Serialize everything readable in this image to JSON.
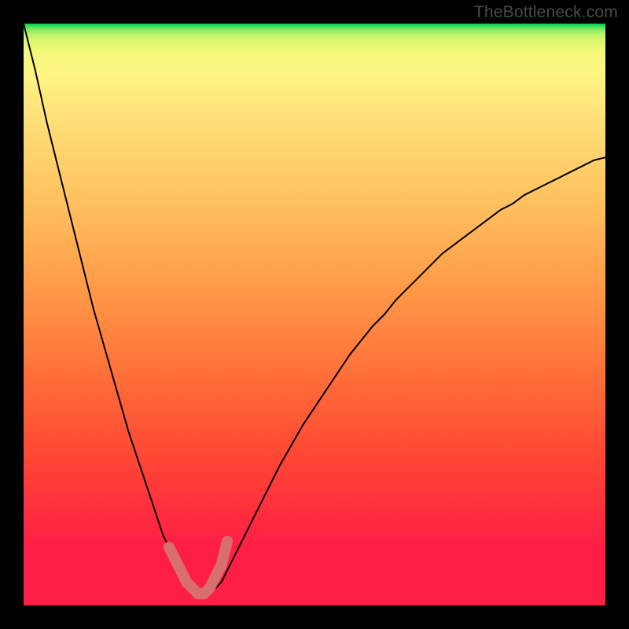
{
  "watermark": "TheBottleneck.com",
  "chart_data": {
    "type": "line",
    "title": "",
    "xlabel": "",
    "ylabel": "",
    "xlim": [
      0,
      100
    ],
    "ylim": [
      0,
      100
    ],
    "x": [
      0,
      2,
      4,
      6,
      8,
      10,
      12,
      14,
      16,
      18,
      20,
      22,
      24,
      26,
      27,
      28,
      29,
      30,
      31,
      32,
      33,
      34,
      36,
      38,
      40,
      42,
      44,
      46,
      48,
      50,
      52,
      54,
      56,
      58,
      60,
      62,
      64,
      66,
      68,
      70,
      72,
      74,
      76,
      78,
      80,
      82,
      84,
      86,
      88,
      90,
      92,
      94,
      96,
      98,
      100
    ],
    "y": [
      100,
      92,
      83,
      75,
      67,
      59,
      51,
      44,
      37,
      30,
      24,
      18,
      12,
      8,
      6,
      4,
      3,
      2,
      2,
      2,
      3,
      4,
      8,
      12,
      16,
      20,
      24,
      27.5,
      31,
      34,
      37,
      40,
      43,
      45.5,
      48,
      50,
      52.5,
      54.5,
      56.5,
      58.5,
      60.5,
      62,
      63.5,
      65,
      66.5,
      68,
      69,
      70.5,
      71.5,
      72.5,
      73.5,
      74.5,
      75.5,
      76.5,
      77
    ],
    "gradient_bands": [
      {
        "y0": 100,
        "y1": 99.5,
        "color": "#00d455"
      },
      {
        "y0": 99.5,
        "y1": 99,
        "color": "#4de05c"
      },
      {
        "y0": 99,
        "y1": 98.3,
        "color": "#88ea62"
      },
      {
        "y0": 98.3,
        "y1": 97.3,
        "color": "#b6f168"
      },
      {
        "y0": 97.3,
        "y1": 95.5,
        "color": "#d9f66f"
      },
      {
        "y0": 95.5,
        "y1": 92,
        "color": "#f1f978"
      },
      {
        "y0": 92,
        "y1": 85,
        "color": "#fef683"
      },
      {
        "y0": 85,
        "y1": 70,
        "color": "#ffe37a"
      },
      {
        "y0": 70,
        "y1": 55,
        "color": "#ffc260"
      },
      {
        "y0": 55,
        "y1": 40,
        "color": "#ff9b48"
      },
      {
        "y0": 40,
        "y1": 25,
        "color": "#ff7038"
      },
      {
        "y0": 25,
        "y1": 10,
        "color": "#ff4534"
      },
      {
        "y0": 10,
        "y1": 0,
        "color": "#ff1e46"
      }
    ],
    "highlight_segment": {
      "x": [
        25,
        26,
        27,
        28,
        29,
        30,
        31,
        32,
        33,
        34,
        35
      ],
      "y": [
        10,
        8,
        6,
        4,
        3,
        2,
        2,
        3,
        5,
        7,
        11
      ],
      "color": "#d86e6e",
      "width": 14
    }
  }
}
